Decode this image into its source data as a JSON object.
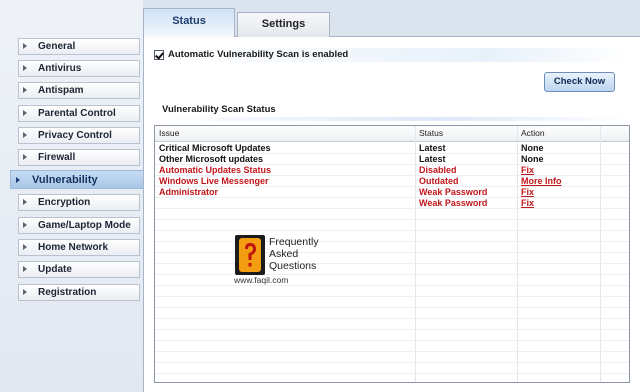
{
  "sidebar": {
    "items": [
      {
        "label": "General"
      },
      {
        "label": "Antivirus"
      },
      {
        "label": "Antispam"
      },
      {
        "label": "Parental Control"
      },
      {
        "label": "Privacy Control"
      },
      {
        "label": "Firewall"
      },
      {
        "label": "Vulnerability",
        "active": true
      },
      {
        "label": "Encryption"
      },
      {
        "label": "Game/Laptop Mode"
      },
      {
        "label": "Home Network"
      },
      {
        "label": "Update"
      },
      {
        "label": "Registration"
      }
    ]
  },
  "tabs": [
    {
      "label": "Status",
      "active": true
    },
    {
      "label": "Settings",
      "active": false
    }
  ],
  "auto_scan": {
    "label": "Automatic Vulnerability Scan is enabled",
    "checked": true
  },
  "check_now_label": "Check Now",
  "scan_status_title": "Vulnerability Scan Status",
  "table": {
    "headers": [
      "Issue",
      "Status",
      "Action"
    ],
    "rows": [
      {
        "issue": "Critical Microsoft Updates",
        "status": "Latest",
        "action": "None",
        "severity": "ok"
      },
      {
        "issue": "Other Microsoft updates",
        "status": "Latest",
        "action": "None",
        "severity": "ok"
      },
      {
        "issue": "Automatic Updates Status",
        "status": "Disabled",
        "action": "Fix",
        "severity": "problem"
      },
      {
        "issue": "Windows Live Messenger",
        "status": "Outdated",
        "action": "More Info",
        "severity": "problem"
      },
      {
        "issue": "Administrator",
        "status": "Weak Password",
        "action": "Fix",
        "severity": "problem"
      },
      {
        "issue": "",
        "status": "Weak Password",
        "action": "Fix",
        "severity": "problem"
      }
    ]
  },
  "watermark": {
    "line1": "Frequently",
    "line2": "Asked",
    "line3": "Questions",
    "url": "www.faqil.com"
  },
  "colors": {
    "problem": "#c1161b",
    "ok": "#111111",
    "accent": "#a8c6e8"
  }
}
